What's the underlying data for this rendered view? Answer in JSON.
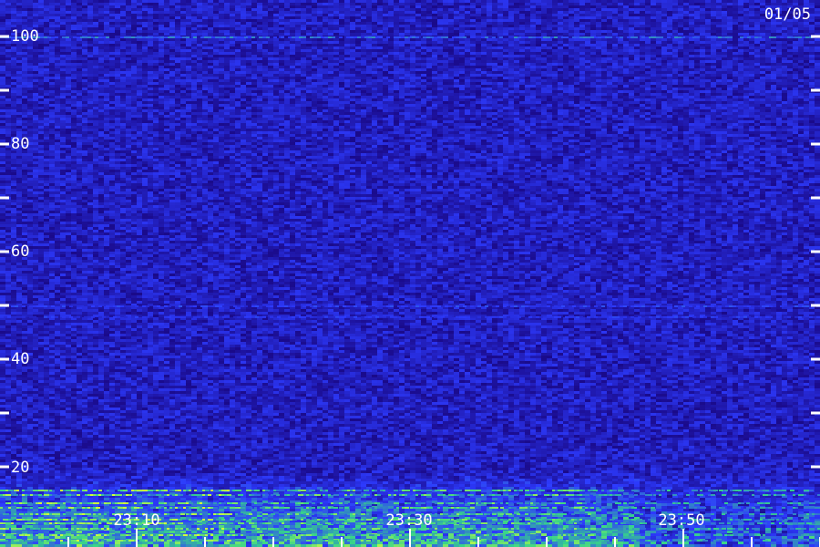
{
  "chart_data": {
    "type": "heatmap",
    "title": "",
    "date_label": "01/05",
    "y_axis": {
      "ylim": [
        0,
        100
      ],
      "labeled_ticks": [
        20,
        40,
        60,
        80,
        100
      ],
      "tick_labels": [
        "20",
        "40",
        "60",
        "80",
        "100"
      ],
      "minor_ticks": [
        30,
        50,
        70,
        90
      ]
    },
    "x_axis": {
      "tick_labels": [
        "23:10",
        "23:30",
        "23:50"
      ],
      "xlim_minutes": [
        "23:00",
        "23:59"
      ]
    },
    "series": [
      {
        "y_range": [
          0,
          100
        ],
        "intensity": 0.35
      },
      {
        "y": 100,
        "intensity": 0.8
      },
      {
        "y": 50,
        "intensity": 0.55
      },
      {
        "y": 48,
        "intensity": 0.5
      },
      {
        "y_range": [
          3,
          12
        ],
        "intensity": 0.9
      }
    ],
    "colors": {
      "background": "#000000",
      "low": "#1a0a8a",
      "mid": "#2d3bff",
      "high": "#37d48a",
      "peak": "#d8ff3a",
      "text": "#ffffff"
    }
  }
}
